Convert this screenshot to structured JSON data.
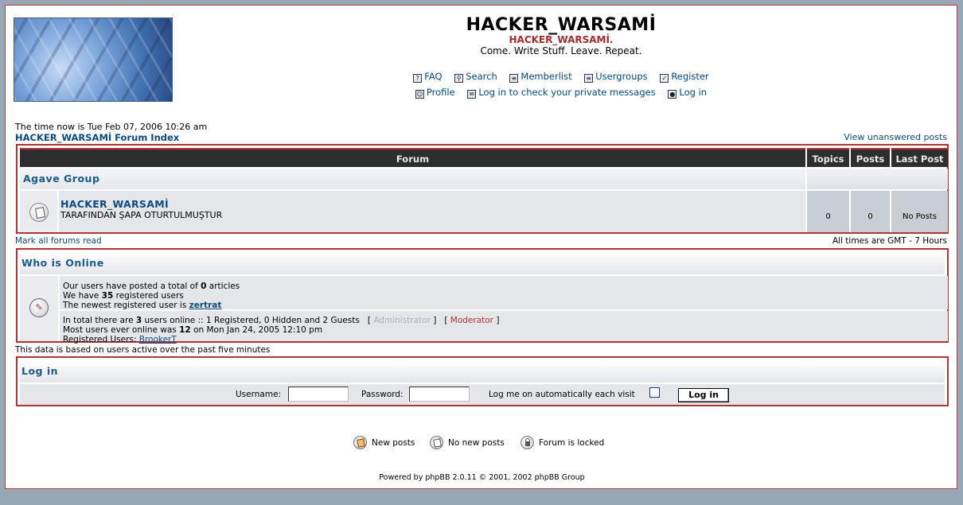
{
  "header": {
    "title": "HACKER_WARSAMİ",
    "subtitle": "HACKER_WARSAMİ.",
    "description": "Come. Write Stuff. Leave. Repeat.",
    "nav_row1": [
      {
        "label": "FAQ",
        "icon": "faq-icon"
      },
      {
        "label": "Search",
        "icon": "search-icon"
      },
      {
        "label": "Memberlist",
        "icon": "memberlist-icon"
      },
      {
        "label": "Usergroups",
        "icon": "usergroups-icon"
      },
      {
        "label": "Register",
        "icon": "register-icon"
      }
    ],
    "nav_row2": [
      {
        "label": "Profile",
        "icon": "profile-icon"
      },
      {
        "label": "Log in to check your private messages",
        "icon": "messages-icon"
      },
      {
        "label": "Log in",
        "icon": "login-icon"
      }
    ]
  },
  "time_now": "The time now is Tue Feb 07, 2006 10:26 am",
  "forum_index_link": "HACKER_WARSAMİ Forum Index",
  "view_unanswered": "View unanswered posts",
  "forum_table": {
    "headers": {
      "forum": "Forum",
      "topics": "Topics",
      "posts": "Posts",
      "last_post": "Last Post"
    },
    "category": "Agave Group",
    "forums": [
      {
        "name": "HACKER_WARSAMİ",
        "description": "TARAFINDAN ŞAPA OTURTULMUŞTUR",
        "topics": "0",
        "posts": "0",
        "last_post": "No Posts"
      }
    ]
  },
  "mark_all_read": "Mark all forums read",
  "timezone": "All times are GMT - 7 Hours",
  "who_is_online": {
    "title": "Who is Online",
    "line1_pre": "Our users have posted a total of ",
    "line1_num": "0",
    "line1_post": " articles",
    "line2_pre": "We have ",
    "line2_num": "35",
    "line2_post": " registered users",
    "line3_pre": "The newest registered user is ",
    "line3_user": "zertrat",
    "line4_pre": "In total there are ",
    "line4_num": "3",
    "line4_post": " users online :: 1 Registered, 0 Hidden and 2 Guests   [ ",
    "admin_label": "Administrator",
    "mid_bracket": " ]   [ ",
    "mod_label": "Moderator",
    "end_bracket": " ]",
    "line5_pre": "Most users ever online was ",
    "line5_num": "12",
    "line5_post": " on Mon Jan 24, 2005 12:10 pm",
    "line6_pre": "Registered Users: ",
    "line6_user": "BrookerT"
  },
  "data_note": "This data is based on users active over the past five minutes",
  "login": {
    "title": "Log in",
    "username_label": "Username:",
    "password_label": "Password:",
    "auto_label": "Log me on automatically each visit",
    "button": "Log in"
  },
  "legend": {
    "new_posts": "New posts",
    "no_new_posts": "No new posts",
    "locked": "Forum is locked"
  },
  "footer": "Powered by phpBB 2.0.11 © 2001, 2002 phpBB Group",
  "colors": {
    "accent_border": "#b03434",
    "link": "#0a4a80",
    "header_bar": "#2e2e2e"
  }
}
